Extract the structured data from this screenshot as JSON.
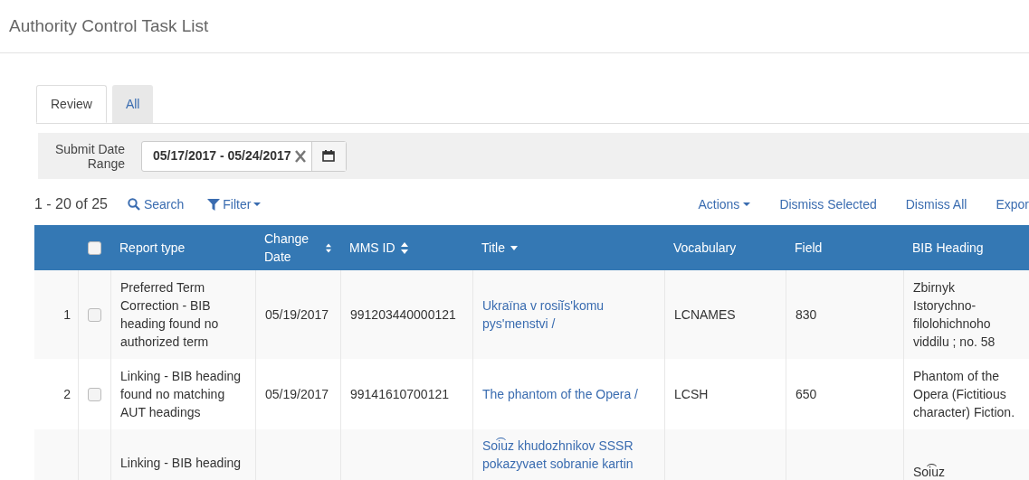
{
  "page_title": "Authority Control Task List",
  "tabs": [
    {
      "label": "Review",
      "selected": true
    },
    {
      "label": "All",
      "selected": false
    }
  ],
  "filter": {
    "label": "Submit Date Range",
    "value": "05/17/2017 - 05/24/2017"
  },
  "toolbar": {
    "count": "1 - 20 of 25",
    "search": "Search",
    "filter": "Filter",
    "actions": [
      "Actions",
      "Dismiss Selected",
      "Dismiss All",
      "Expor"
    ]
  },
  "table": {
    "select_all_checked": false,
    "columns": [
      {
        "label": "Report type"
      },
      {
        "label": "Change Date",
        "sortable": true
      },
      {
        "label": "MMS ID",
        "sortable": true
      },
      {
        "label": "Title",
        "sortable": true,
        "sorted": true
      },
      {
        "label": "Vocabulary"
      },
      {
        "label": "Field"
      },
      {
        "label": "BIB Heading"
      }
    ],
    "rows": [
      {
        "number": "1",
        "checked": false,
        "report_type": "Preferred Term Correction - BIB heading found no authorized term",
        "change_date": "05/19/2017",
        "mms_id": "991203440000121",
        "title": "Ukraïna v rosiĭs'komu pys'menstvi /",
        "vocabulary": "LCNAMES",
        "field": "830",
        "bib_heading": "Zbirnyk Istorychno-filolohichnoho viddilu ; no. 58"
      },
      {
        "number": "2",
        "checked": false,
        "report_type": "Linking - BIB heading found no matching AUT headings",
        "change_date": "05/19/2017",
        "mms_id": "99141610700121",
        "title": "The phantom of the Opera /",
        "vocabulary": "LCSH",
        "field": "650",
        "bib_heading": "Phantom of the Opera (Fictitious character) Fiction."
      },
      {
        "report_type": "Linking - BIB heading",
        "title": "Soi͡uz khudozhnikov SSSR pokazyvaet sobranie kartin",
        "bib_heading": "Soi͡uz"
      }
    ]
  }
}
